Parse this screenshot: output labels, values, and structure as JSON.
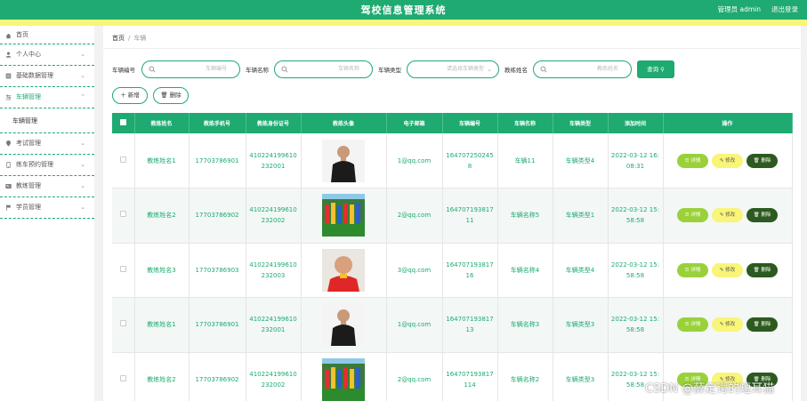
{
  "header": {
    "title": "驾校信息管理系统",
    "user": "管理员 admin",
    "logout": "退出登录",
    "bg_color": "#1eaa70",
    "accent_bar_color": "#f8f578"
  },
  "sidebar": {
    "items": [
      {
        "label": "首页",
        "icon": "home-icon"
      },
      {
        "label": "个人中心",
        "icon": "user-icon"
      },
      {
        "label": "基础数据管理",
        "icon": "database-icon"
      },
      {
        "label": "车辆管理",
        "icon": "car-icon"
      },
      {
        "label": "考试管理",
        "icon": "location-icon"
      },
      {
        "label": "练车预约管理",
        "icon": "phone-icon"
      },
      {
        "label": "教练管理",
        "icon": "id-card-icon"
      },
      {
        "label": "学员管理",
        "icon": "flag-icon"
      }
    ],
    "submenu": [
      "车辆管理"
    ]
  },
  "breadcrumb": {
    "home": "首页",
    "separator": "/",
    "current": "车辆"
  },
  "search": {
    "fields": [
      {
        "label": "车辆编号",
        "placeholder": "车辆编号"
      },
      {
        "label": "车辆名称",
        "placeholder": "车辆名称"
      },
      {
        "label": "车辆类型",
        "placeholder": "请选择车辆类型"
      },
      {
        "label": "教练姓名",
        "placeholder": "教练姓名"
      }
    ],
    "button": "查询"
  },
  "actions": {
    "add": "新增",
    "delete": "删除"
  },
  "table": {
    "columns": [
      "教练姓名",
      "教练手机号",
      "教练身份证号",
      "教练头像",
      "电子邮箱",
      "车辆编号",
      "车辆名称",
      "车辆类型",
      "添加时间",
      "操作"
    ],
    "rows": [
      {
        "name": "教练姓名1",
        "phone": "17703786901",
        "idcard": "410224199610232001",
        "avatar": "coach-avatar-black-shirt",
        "email": "1@qq.com",
        "car_no": "1647072502458",
        "car_name": "车辆11",
        "car_type": "车辆类型4",
        "time": "2022-03-12 16:08:31"
      },
      {
        "name": "教练姓名2",
        "phone": "17703786902",
        "idcard": "410224199610232002",
        "avatar": "coach-avatar-team-photo",
        "email": "2@qq.com",
        "car_no": "16470719381711",
        "car_name": "车辆名称5",
        "car_type": "车辆类型1",
        "time": "2022-03-12 15:58:58"
      },
      {
        "name": "教练姓名3",
        "phone": "17703786903",
        "idcard": "410224199610232003",
        "avatar": "coach-avatar-elderly-man",
        "email": "3@qq.com",
        "car_no": "16470719381716",
        "car_name": "车辆名称4",
        "car_type": "车辆类型4",
        "time": "2022-03-12 15:58:58"
      },
      {
        "name": "教练姓名1",
        "phone": "17703786901",
        "idcard": "410224199610232001",
        "avatar": "coach-avatar-black-shirt",
        "email": "1@qq.com",
        "car_no": "16470719381713",
        "car_name": "车辆名称3",
        "car_type": "车辆类型3",
        "time": "2022-03-12 15:58:58"
      },
      {
        "name": "教练姓名2",
        "phone": "17703786902",
        "idcard": "410224199610232002",
        "avatar": "coach-avatar-team-photo",
        "email": "2@qq.com",
        "car_no": "164707193817114",
        "car_name": "车辆名称2",
        "car_type": "车辆类型3",
        "time": "2022-03-12 15:58:58"
      }
    ],
    "row_actions": {
      "detail": "详情",
      "edit": "修改",
      "delete": "删除"
    }
  },
  "watermark": "CSDN @薛定谔的短耳猫"
}
